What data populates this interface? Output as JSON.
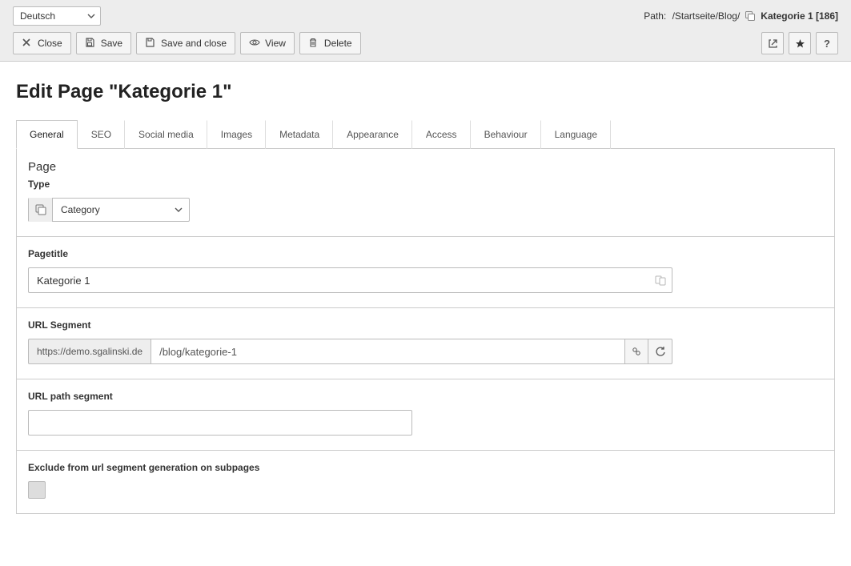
{
  "topbar": {
    "language": "Deutsch",
    "breadcrumb_label": "Path:",
    "breadcrumb_path": "/Startseite/Blog/",
    "breadcrumb_current": "Kategorie 1 [186]"
  },
  "actions": {
    "close": "Close",
    "save": "Save",
    "save_and_close": "Save and close",
    "view": "View",
    "delete": "Delete"
  },
  "page_title": "Edit Page \"Kategorie 1\"",
  "tabs": {
    "general": "General",
    "seo": "SEO",
    "social": "Social media",
    "images": "Images",
    "metadata": "Metadata",
    "appearance": "Appearance",
    "access": "Access",
    "behaviour": "Behaviour",
    "language": "Language"
  },
  "form": {
    "section_page": "Page",
    "type_label": "Type",
    "type_value": "Category",
    "pagetitle_label": "Pagetitle",
    "pagetitle_value": "Kategorie 1",
    "url_segment_label": "URL Segment",
    "url_prefix": "https://demo.sgalinski.de",
    "url_segment_value": "/blog/kategorie-1",
    "url_path_segment_label": "URL path segment",
    "url_path_segment_value": "",
    "exclude_label": "Exclude from url segment generation on subpages"
  }
}
